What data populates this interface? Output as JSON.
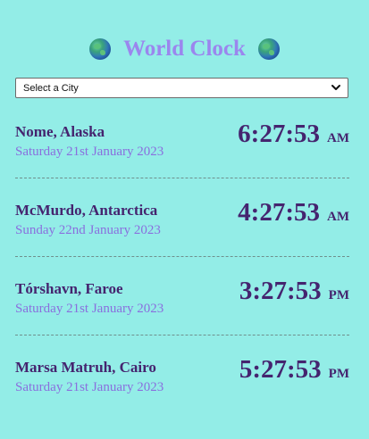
{
  "header": {
    "title": "World Clock",
    "left_icon": "globe-icon",
    "right_icon": "globe-icon"
  },
  "city_select": {
    "value": "Select a City",
    "icon": "chevron-down-icon"
  },
  "cities": [
    {
      "name": "Nome, Alaska",
      "date": "Saturday 21st January 2023",
      "time": "6:27:53",
      "ampm": "AM"
    },
    {
      "name": "McMurdo, Antarctica",
      "date": "Sunday 22nd January 2023",
      "time": "4:27:53",
      "ampm": "AM"
    },
    {
      "name": "Tórshavn, Faroe",
      "date": "Saturday 21st January 2023",
      "time": "3:27:53",
      "ampm": "PM"
    },
    {
      "name": "Marsa Matruh, Cairo",
      "date": "Saturday 21st January 2023",
      "time": "5:27:53",
      "ampm": "PM"
    }
  ],
  "colors": {
    "background": "#93ede7",
    "title": "#9b86ee",
    "city_name": "#45246f",
    "date": "#8a6fde"
  }
}
